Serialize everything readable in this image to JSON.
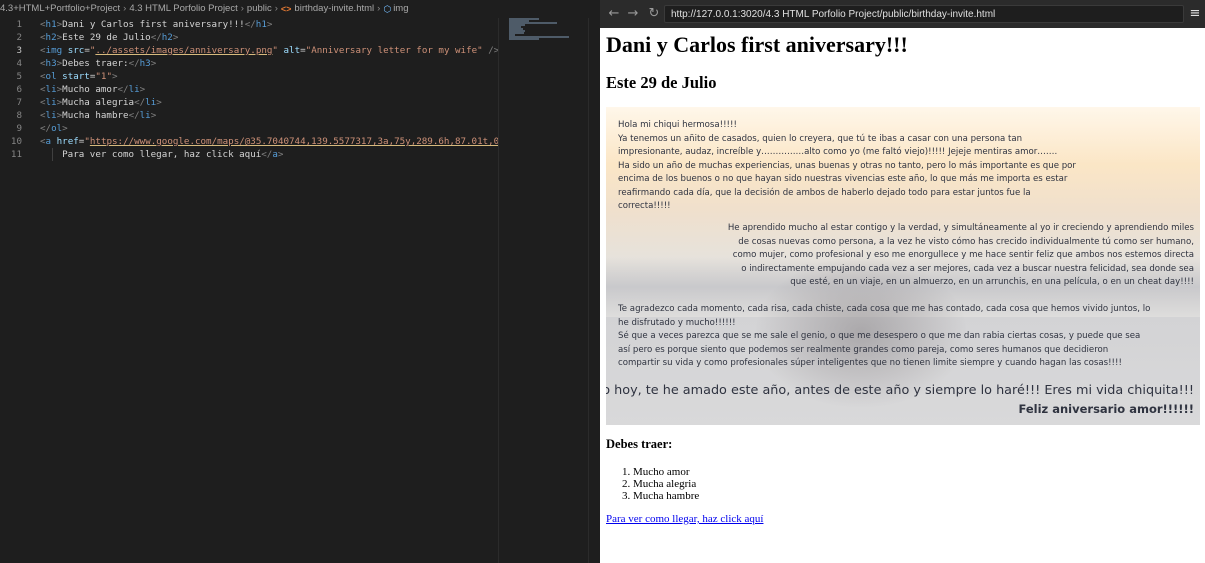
{
  "editor": {
    "breadcrumb": [
      "4.3+HTML+Portfolio+Project",
      "4.3 HTML Porfolio Project",
      "public",
      "birthday-invite.html",
      "img"
    ],
    "active_line": 3,
    "lines": [
      {
        "n": "1",
        "segments": [
          [
            "ang",
            "<"
          ],
          [
            "tag",
            "h1"
          ],
          [
            "ang",
            ">"
          ],
          [
            "txt",
            "Dani y Carlos first aniversary!!!"
          ],
          [
            "ang",
            "</"
          ],
          [
            "tag",
            "h1"
          ],
          [
            "ang",
            ">"
          ]
        ]
      },
      {
        "n": "2",
        "segments": [
          [
            "ang",
            "<"
          ],
          [
            "tag",
            "h2"
          ],
          [
            "ang",
            ">"
          ],
          [
            "txt",
            "Este 29 de Julio"
          ],
          [
            "ang",
            "</"
          ],
          [
            "tag",
            "h2"
          ],
          [
            "ang",
            ">"
          ]
        ]
      },
      {
        "n": "3",
        "segments": [
          [
            "ang",
            "<"
          ],
          [
            "tag",
            "img"
          ],
          [
            "txt",
            " "
          ],
          [
            "attr",
            "src"
          ],
          [
            "txt",
            "="
          ],
          [
            "str",
            "\""
          ],
          [
            "str-u",
            "../assets/images/anniversary.png"
          ],
          [
            "str",
            "\""
          ],
          [
            "txt",
            " "
          ],
          [
            "attr",
            "alt"
          ],
          [
            "txt",
            "="
          ],
          [
            "str",
            "\"Anniversary letter for my wife\""
          ],
          [
            "txt",
            " "
          ],
          [
            "ang",
            "/>"
          ]
        ]
      },
      {
        "n": "4",
        "segments": [
          [
            "ang",
            "<"
          ],
          [
            "tag",
            "h3"
          ],
          [
            "ang",
            ">"
          ],
          [
            "txt",
            "Debes traer:"
          ],
          [
            "ang",
            "</"
          ],
          [
            "tag",
            "h3"
          ],
          [
            "ang",
            ">"
          ]
        ]
      },
      {
        "n": "5",
        "segments": [
          [
            "ang",
            "<"
          ],
          [
            "tag",
            "ol"
          ],
          [
            "txt",
            " "
          ],
          [
            "attr",
            "start"
          ],
          [
            "txt",
            "="
          ],
          [
            "str",
            "\"1\""
          ],
          [
            "ang",
            ">"
          ]
        ]
      },
      {
        "n": "6",
        "segments": [
          [
            "ang",
            "<"
          ],
          [
            "tag",
            "li"
          ],
          [
            "ang",
            ">"
          ],
          [
            "txt",
            "Mucho amor"
          ],
          [
            "ang",
            "</"
          ],
          [
            "tag",
            "li"
          ],
          [
            "ang",
            ">"
          ]
        ]
      },
      {
        "n": "7",
        "segments": [
          [
            "ang",
            "<"
          ],
          [
            "tag",
            "li"
          ],
          [
            "ang",
            ">"
          ],
          [
            "txt",
            "Mucha alegria"
          ],
          [
            "ang",
            "</"
          ],
          [
            "tag",
            "li"
          ],
          [
            "ang",
            ">"
          ]
        ]
      },
      {
        "n": "8",
        "segments": [
          [
            "ang",
            "<"
          ],
          [
            "tag",
            "li"
          ],
          [
            "ang",
            ">"
          ],
          [
            "txt",
            "Mucha hambre"
          ],
          [
            "ang",
            "</"
          ],
          [
            "tag",
            "li"
          ],
          [
            "ang",
            ">"
          ]
        ]
      },
      {
        "n": "9",
        "segments": [
          [
            "ang",
            "</"
          ],
          [
            "tag",
            "ol"
          ],
          [
            "ang",
            ">"
          ]
        ]
      },
      {
        "n": "10",
        "segments": [
          [
            "ang",
            "<"
          ],
          [
            "tag",
            "a"
          ],
          [
            "txt",
            " "
          ],
          [
            "attr",
            "href"
          ],
          [
            "txt",
            "="
          ],
          [
            "str",
            "\""
          ],
          [
            "str-u",
            "https://www.google.com/maps/@35.7040744,139.5577317,3a,75y,289.6h,87.01t,0.72"
          ]
        ]
      },
      {
        "n": "11",
        "segments": [
          [
            "txt",
            "    Para ver como llegar, haz click aquí"
          ],
          [
            "ang",
            "</"
          ],
          [
            "tag",
            "a"
          ],
          [
            "ang",
            ">"
          ]
        ]
      }
    ]
  },
  "browser": {
    "back_icon": "arrow-left-icon",
    "forward_icon": "arrow-right-icon",
    "reload_icon": "reload-icon",
    "menu_icon": "hamburger-menu-icon",
    "url": "http://127.0.0.1:3020/4.3 HTML Porfolio Project/public/birthday-invite.html"
  },
  "page": {
    "h1": "Dani y Carlos first aniversary!!!",
    "h2": "Este 29 de Julio",
    "h3": "Debes traer:",
    "list": [
      "Mucho amor",
      "Mucha alegria",
      "Mucha hambre"
    ],
    "link_text": "Para ver como llegar, haz click aquí",
    "letter": {
      "p1": [
        "Hola mi chiqui hermosa!!!!!",
        "Ya tenemos un añito de casados, quien lo creyera, que tú te ibas a casar con una persona tan",
        "impresionante, audaz, increíble y……………alto como yo (me faltó viejo)!!!!! Jejeje mentiras amor…….",
        "Ha sido un año de muchas experiencias, unas buenas y otras no tanto, pero lo más importante es que por",
        "encima de los buenos o no que hayan sido nuestras vivencias este año, lo que más me importa es estar",
        "reafirmando cada día, que la decisión de ambos de haberlo dejado todo para estar juntos fue la",
        "correcta!!!!!"
      ],
      "p2": [
        "He aprendido mucho al estar contigo y la verdad, y simultáneamente al yo ir creciendo y aprendiendo miles",
        "de cosas nuevas como persona, a la vez he visto cómo has crecido individualmente tú como ser humano,",
        "como mujer, como profesional y eso me enorgullece y me hace sentir feliz que ambos nos estemos directa",
        "o indirectamente empujando cada vez a ser mejores, cada vez a buscar nuestra felicidad, sea donde sea",
        "que esté, en un viaje, en un almuerzo, en un arrunchis, en una película, o en un cheat day!!!!"
      ],
      "p3": [
        "Te agradezco cada momento, cada risa, cada chiste, cada cosa que me has contado, cada cosa que hemos vivido juntos, lo",
        "he disfrutado y mucho!!!!!!",
        "Sé que a veces parezca que se me sale el genio, o que me desespero o que me dan rabia ciertas cosas, y puede que sea",
        "así pero es porque siento que podemos ser realmente grandes como pareja, como seres humanos que decidieron",
        "compartir su vida y como profesionales súper inteligentes que no tienen limite siempre y cuando hagan las cosas!!!!"
      ],
      "closing": "Te amo hoy, te he amado este año, antes de este año y siempre lo haré!!! Eres mi vida chiquita!!!",
      "signoff": "Feliz aniversario amor!!!!!!"
    }
  }
}
